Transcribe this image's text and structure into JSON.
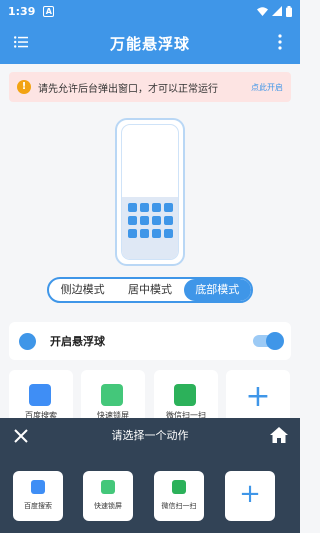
{
  "status_bar": {
    "time": "1:39",
    "notification_letter": "A"
  },
  "app_bar": {
    "title": "万能悬浮球"
  },
  "warning": {
    "icon_text": "!",
    "message": "请先允许后台弹出窗口，才可以正常运行",
    "link": "点此开启"
  },
  "modes": {
    "items": [
      "侧边模式",
      "居中模式",
      "底部模式"
    ],
    "selected": "底部模式"
  },
  "float_toggle": {
    "label": "开启悬浮球",
    "enabled": true
  },
  "actions": [
    {
      "label": "百度搜索",
      "icon": "baidu-icon",
      "color": "#3f8ef5"
    },
    {
      "label": "快速锁屏",
      "icon": "lock-icon",
      "color": "#44c77a"
    },
    {
      "label": "微信扫一扫",
      "icon": "scan-icon",
      "color": "#2cb15a"
    }
  ],
  "sheet": {
    "title": "请选择一个动作",
    "add_symbol": "+"
  },
  "colors": {
    "primary": "#3f96e8",
    "sheet_bg": "#324356",
    "warning_bg": "#fde4e3"
  }
}
